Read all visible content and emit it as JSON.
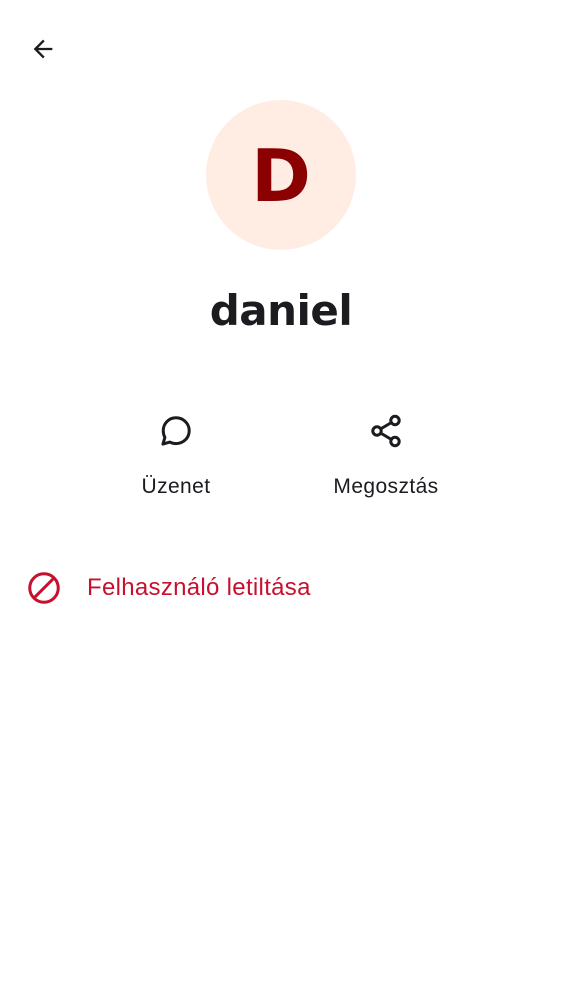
{
  "header": {
    "back_icon": "arrow-left-icon"
  },
  "profile": {
    "avatar_letter": "D",
    "avatar_background": "#ffede4",
    "avatar_letter_color": "#8b0000",
    "name": "daniel"
  },
  "actions": [
    {
      "label": "Üzenet",
      "icon": "chat-bubble-icon"
    },
    {
      "label": "Megosztás",
      "icon": "share-icon"
    }
  ],
  "block": {
    "label": "Felhasználó letiltása",
    "icon": "block-icon",
    "color": "#c8102e"
  }
}
